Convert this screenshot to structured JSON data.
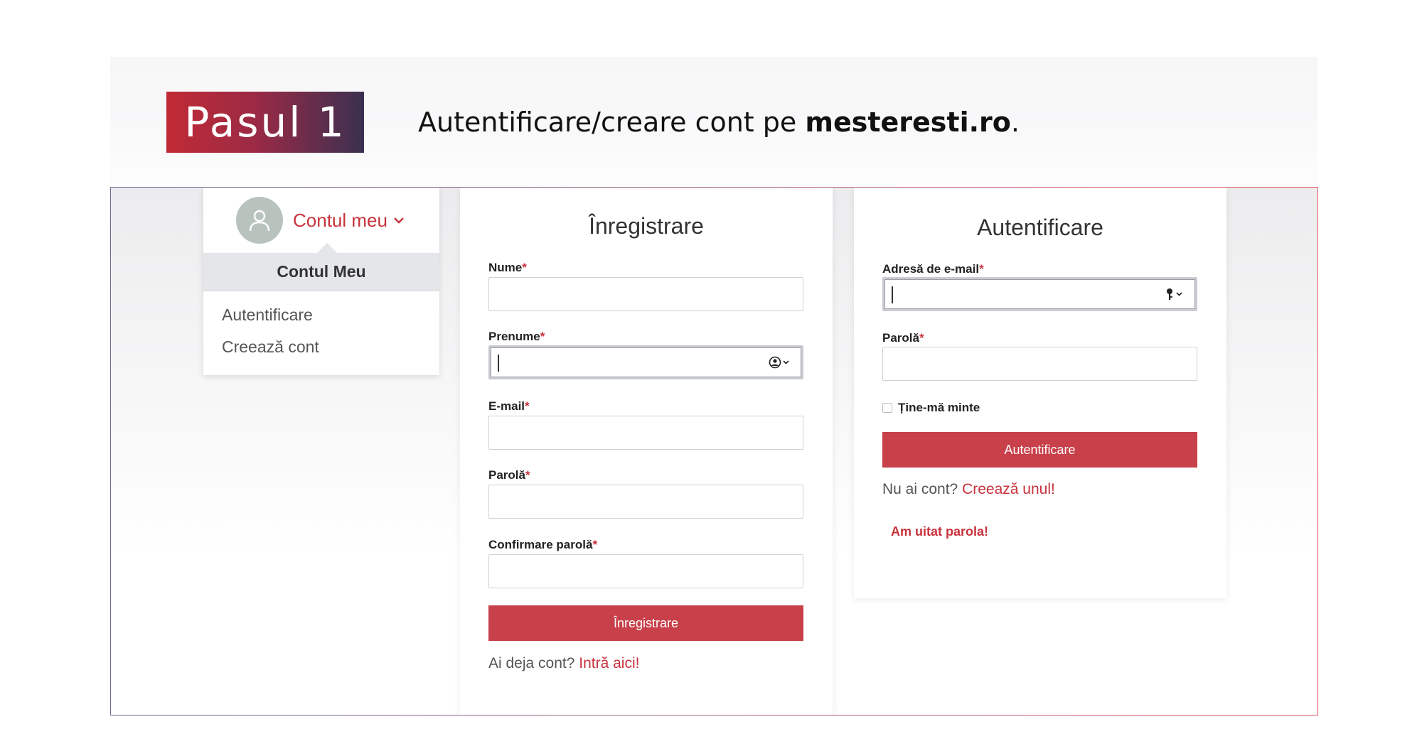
{
  "step": {
    "badge": "Pasul 1",
    "caption_prefix": "Autentificare/creare cont pe ",
    "caption_domain": "mesteresti.ro",
    "caption_suffix": "."
  },
  "account_menu": {
    "trigger_label": "Contul meu",
    "header": "Contul Meu",
    "items": [
      "Autentificare",
      "Creează cont"
    ]
  },
  "register": {
    "title": "Înregistrare",
    "fields": [
      {
        "label": "Nume",
        "value": ""
      },
      {
        "label": "Prenume",
        "value": ""
      },
      {
        "label": "E-mail",
        "value": ""
      },
      {
        "label": "Parolă",
        "value": ""
      },
      {
        "label": "Confirmare parolă",
        "value": ""
      }
    ],
    "required_mark": "*",
    "submit_label": "Înregistrare",
    "prompt_text": "Ai deja cont? ",
    "prompt_link": "Intră aici!"
  },
  "login": {
    "title": "Autentificare",
    "fields": [
      {
        "label": "Adresă de e-mail",
        "value": ""
      },
      {
        "label": "Parolă",
        "value": ""
      }
    ],
    "required_mark": "*",
    "remember_label": "Ține-mă minte",
    "remember_checked": false,
    "submit_label": "Autentificare",
    "prompt_text": "Nu ai cont? ",
    "prompt_link": "Creează unul!",
    "forgot_link": "Am uitat parola!"
  },
  "icons": {
    "account": "user-icon",
    "chevron": "chevron-down-icon",
    "contact_autofill": "person-circle-autofill-icon",
    "password_autofill": "key-autofill-icon"
  },
  "colors": {
    "accent": "#c8323c",
    "button": "#c8404a",
    "badge_start": "#c12a35",
    "badge_end": "#3a3050",
    "avatar": "#b9c3be"
  }
}
